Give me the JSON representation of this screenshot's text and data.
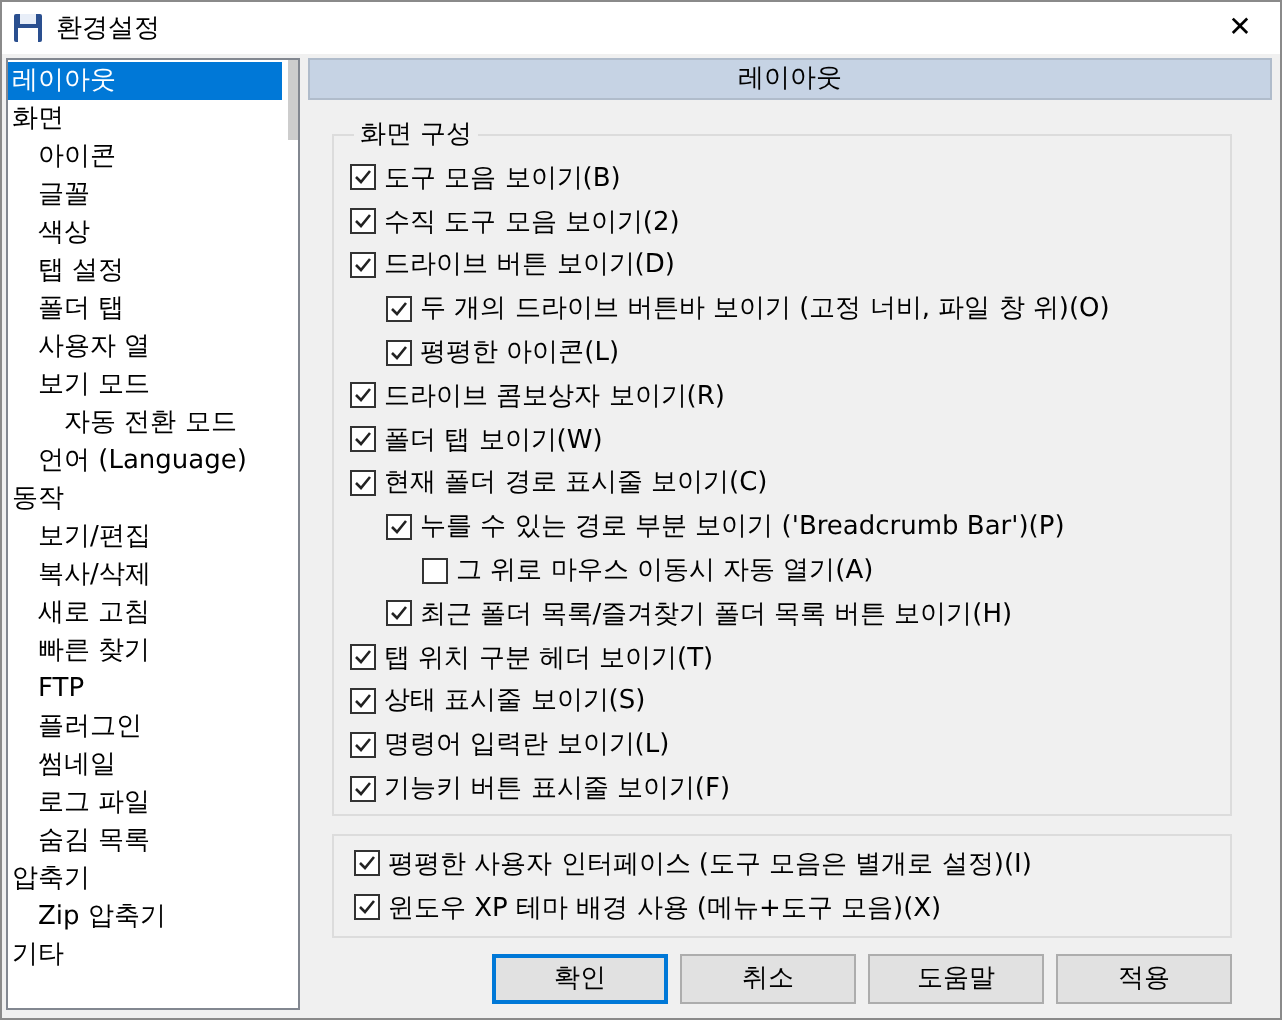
{
  "window": {
    "title": "환경설정",
    "close": "✕"
  },
  "sidebar": {
    "items": [
      {
        "label": "레이아웃",
        "selected": true
      },
      {
        "label": "화면",
        "selected": false,
        "children": [
          {
            "label": "아이콘",
            "selected": false
          },
          {
            "label": "글꼴",
            "selected": false
          },
          {
            "label": "색상",
            "selected": false
          },
          {
            "label": "탭 설정",
            "selected": false
          },
          {
            "label": "폴더 탭",
            "selected": false
          },
          {
            "label": "사용자 열",
            "selected": false
          },
          {
            "label": "보기 모드",
            "selected": false,
            "children": [
              {
                "label": "자동 전환 모드",
                "selected": false
              }
            ]
          },
          {
            "label": "언어 (Language)",
            "selected": false
          }
        ]
      },
      {
        "label": "동작",
        "selected": false,
        "children": [
          {
            "label": "보기/편집",
            "selected": false
          },
          {
            "label": "복사/삭제",
            "selected": false
          },
          {
            "label": "새로 고침",
            "selected": false
          },
          {
            "label": "빠른 찾기",
            "selected": false
          },
          {
            "label": "FTP",
            "selected": false
          },
          {
            "label": "플러그인",
            "selected": false
          },
          {
            "label": "썸네일",
            "selected": false
          },
          {
            "label": "로그 파일",
            "selected": false
          },
          {
            "label": "숨김 목록",
            "selected": false
          }
        ]
      },
      {
        "label": "압축기",
        "selected": false,
        "children": [
          {
            "label": "Zip 압축기",
            "selected": false
          }
        ]
      },
      {
        "label": "기타",
        "selected": false
      }
    ]
  },
  "panel": {
    "title": "레이아웃",
    "screen_group": {
      "title": "화면 구성",
      "options": [
        {
          "label": "도구 모음 보이기(B)",
          "checked": true
        },
        {
          "label": "수직 도구 모음 보이기(2)",
          "checked": true
        },
        {
          "label": "드라이브 버튼 보이기(D)",
          "checked": true,
          "children": [
            {
              "label": "두 개의 드라이브 버튼바 보이기 (고정 너비, 파일 창 위)(O)",
              "checked": true
            },
            {
              "label": "평평한 아이콘(L)",
              "checked": true
            }
          ]
        },
        {
          "label": "드라이브 콤보상자 보이기(R)",
          "checked": true
        },
        {
          "label": "폴더 탭 보이기(W)",
          "checked": true
        },
        {
          "label": "현재 폴더 경로 표시줄 보이기(C)",
          "checked": true,
          "children": [
            {
              "label": "누를 수 있는 경로 부분 보이기 ('Breadcrumb Bar')(P)",
              "checked": true,
              "children": [
                {
                  "label": "그 위로 마우스 이동시 자동 열기(A)",
                  "checked": false
                }
              ]
            },
            {
              "label": "최근 폴더 목록/즐겨찾기 폴더 목록 버튼 보이기(H)",
              "checked": true
            }
          ]
        },
        {
          "label": "탭 위치 구분 헤더 보이기(T)",
          "checked": true
        },
        {
          "label": "상태 표시줄 보이기(S)",
          "checked": true
        },
        {
          "label": "명령어 입력란 보이기(L)",
          "checked": true
        },
        {
          "label": "기능키 버튼 표시줄 보이기(F)",
          "checked": true
        }
      ]
    },
    "ui_group": {
      "options": [
        {
          "label": "평평한 사용자 인터페이스 (도구 모음은 별개로 설정)(I)",
          "checked": true
        },
        {
          "label": "윈도우 XP 테마 배경 사용 (메뉴+도구 모음)(X)",
          "checked": true
        }
      ]
    }
  },
  "buttons": [
    {
      "label": "확인",
      "kind": "default"
    },
    {
      "label": "취소",
      "kind": "normal"
    },
    {
      "label": "도움말",
      "kind": "normal"
    },
    {
      "label": "적용",
      "kind": "normal"
    }
  ]
}
